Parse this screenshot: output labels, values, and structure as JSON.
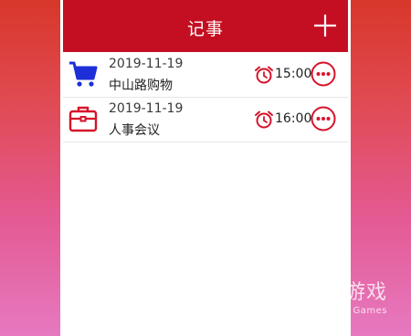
{
  "header": {
    "title": "记事",
    "add_label": "+"
  },
  "items": [
    {
      "date": "2019-11-19",
      "name": "中山路购物",
      "time": "15:00",
      "icon": "shopping-cart-icon"
    },
    {
      "date": "2019-11-19",
      "name": "人事会议",
      "time": "16:00",
      "icon": "briefcase-icon"
    }
  ],
  "watermark": {
    "cn": "仍玩游戏",
    "en": "Rengwan Games"
  },
  "colors": {
    "header": "#c40f22",
    "accent_red": "#d6132a",
    "cart_blue": "#1d2fd8"
  }
}
